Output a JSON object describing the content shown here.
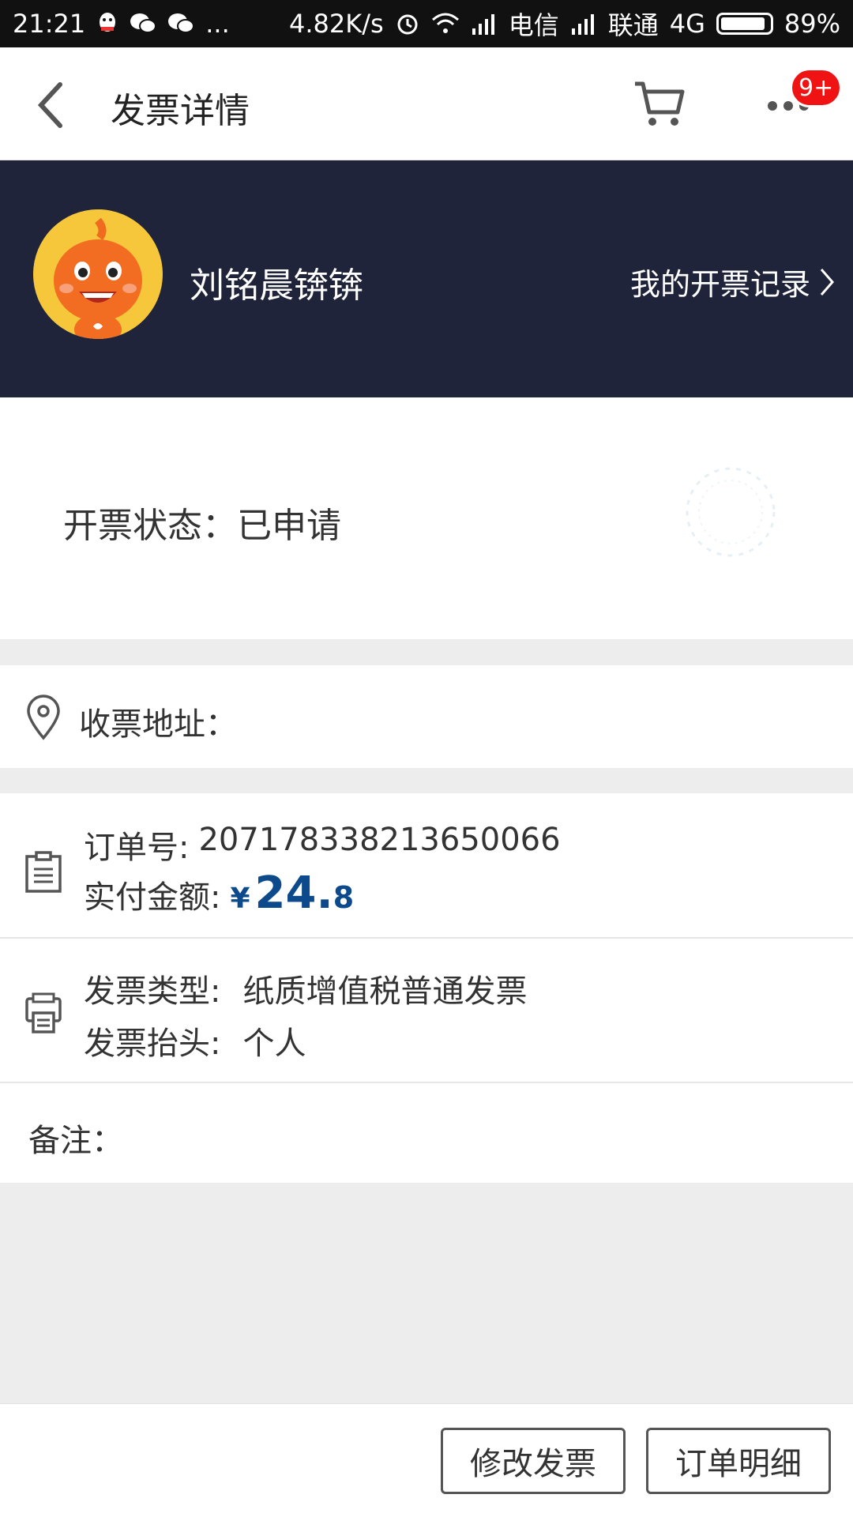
{
  "status_bar": {
    "time": "21:21",
    "network_speed": "4.82K/s",
    "carrier1": "电信",
    "carrier2": "联通",
    "network_type": "4G",
    "battery": "89%",
    "more": "..."
  },
  "nav": {
    "title": "发票详情",
    "badge": "9+"
  },
  "header": {
    "username": "刘铭晨锛锛",
    "records_link": "我的开票记录"
  },
  "status": {
    "label": "开票状态：已申请"
  },
  "address": {
    "label": "收票地址："
  },
  "order": {
    "order_no_label": "订单号:",
    "order_no": "2071783382136500​66",
    "paid_label": "实付金额:",
    "currency": "¥",
    "amount_int": "24.",
    "amount_dec": "8"
  },
  "invoice": {
    "type_label": "发票类型:",
    "type_value": "纸质增值税普通发票",
    "title_label": "发票抬头:",
    "title_value": "个人"
  },
  "remark": {
    "label": "备注："
  },
  "footer": {
    "modify_button": "修改发票",
    "detail_button": "订单明细"
  },
  "colors": {
    "header_bg": "#20243a",
    "price": "#0c4a8c",
    "badge": "#f01313"
  }
}
